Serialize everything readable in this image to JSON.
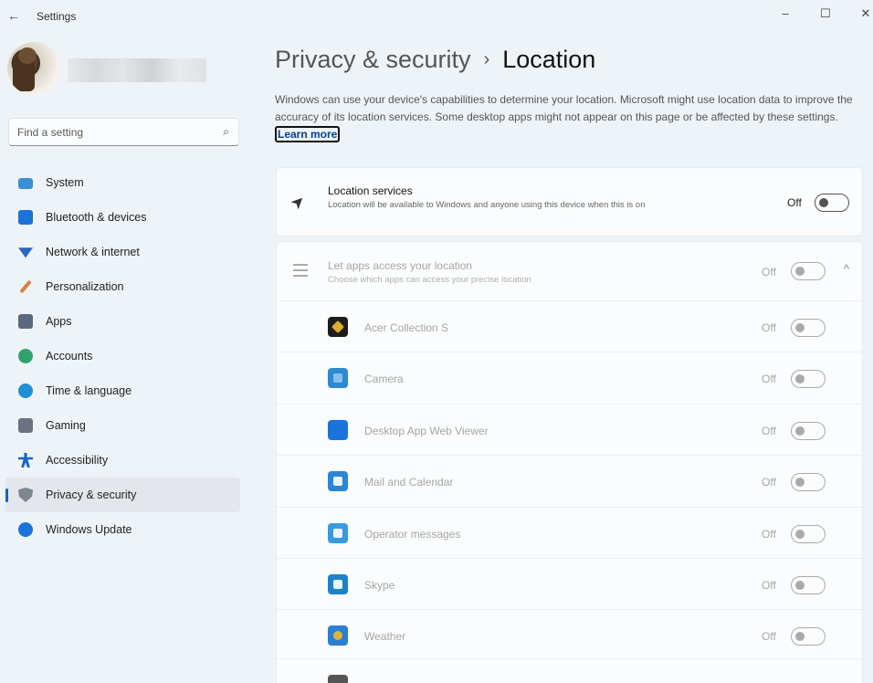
{
  "window": {
    "title": "Settings",
    "back_icon": "←",
    "minimize_icon": "–",
    "maximize_icon": "☐",
    "close_icon": "✕"
  },
  "search": {
    "placeholder": "Find a setting",
    "icon": "⌕"
  },
  "sidebar": {
    "items": [
      {
        "label": "System",
        "icon": "system-icon",
        "color": "#3b8ed8"
      },
      {
        "label": "Bluetooth & devices",
        "icon": "bluetooth-icon",
        "color": "#1a73d9"
      },
      {
        "label": "Network & internet",
        "icon": "network-icon",
        "color": "#2b65c4"
      },
      {
        "label": "Personalization",
        "icon": "brush-icon",
        "color": "#d9823b"
      },
      {
        "label": "Apps",
        "icon": "apps-icon",
        "color": "#5a6a7e"
      },
      {
        "label": "Accounts",
        "icon": "accounts-icon",
        "color": "#2fa36b"
      },
      {
        "label": "Time & language",
        "icon": "globe-icon",
        "color": "#1f8fd6"
      },
      {
        "label": "Gaming",
        "icon": "gaming-icon",
        "color": "#6b7280"
      },
      {
        "label": "Accessibility",
        "icon": "accessibility-icon",
        "color": "#1a66c2"
      },
      {
        "label": "Privacy & security",
        "icon": "shield-icon",
        "color": "#7c8590",
        "active": true
      },
      {
        "label": "Windows Update",
        "icon": "update-icon",
        "color": "#1a73d9"
      }
    ]
  },
  "main": {
    "breadcrumb_parent": "Privacy & security",
    "breadcrumb_sep": "›",
    "breadcrumb_current": "Location",
    "description": "Windows can use your device's capabilities to determine your location. Microsoft might use location data to improve the accuracy of its location services. Some desktop apps might not appear on this page or be affected by these settings.",
    "learn_more": "Learn more",
    "location_services": {
      "title": "Location services",
      "subtitle": "Location will be available to Windows and anyone using this device when this is on",
      "state": "Off"
    },
    "apps_access": {
      "title": "Let apps access your location",
      "subtitle": "Choose which apps can access your precise location",
      "state": "Off",
      "chevron": "^"
    },
    "apps": [
      {
        "name": "Acer Collection S",
        "state": "Off",
        "icon_color": "#1d1d1d",
        "accent": "#f2c12e"
      },
      {
        "name": "Camera",
        "state": "Off",
        "icon_color": "#2e8ad0",
        "accent": "#8fc6ee"
      },
      {
        "name": "Desktop App Web Viewer",
        "state": "Off",
        "icon_color": "#1a73d9",
        "accent": "#1a73d9"
      },
      {
        "name": "Mail and Calendar",
        "state": "Off",
        "icon_color": "#2a86d8",
        "accent": "#ffffff"
      },
      {
        "name": "Operator messages",
        "state": "Off",
        "icon_color": "#3a9ae0",
        "accent": "#ffffff"
      },
      {
        "name": "Skype",
        "state": "Off",
        "icon_color": "#1e82c8",
        "accent": "#ffffff"
      },
      {
        "name": "Weather",
        "state": "Off",
        "icon_color": "#2a7fd0",
        "accent": "#f5b82e"
      }
    ]
  }
}
